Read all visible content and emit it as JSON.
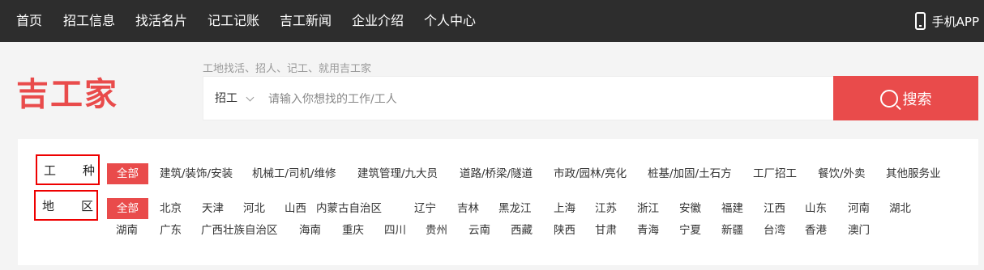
{
  "nav": {
    "items": [
      "首页",
      "招工信息",
      "找活名片",
      "记工记账",
      "吉工新闻",
      "企业介绍",
      "个人中心"
    ],
    "app_label": "手机APP"
  },
  "header": {
    "logo": "吉工家",
    "slogan": "工地找活、招人、记工、就用吉工家"
  },
  "search": {
    "type": "招工",
    "placeholder": "请输入你想找的工作/工人",
    "button_label": "搜索"
  },
  "filters": {
    "trade": {
      "label_a": "工",
      "label_b": "种",
      "options": [
        "全部",
        "建筑/装饰/安装",
        "机械工/司机/维修",
        "建筑管理/九大员",
        "道路/桥梁/隧道",
        "市政/园林/亮化",
        "桩基/加固/土石方",
        "工厂招工",
        "餐饮/外卖",
        "其他服务业"
      ]
    },
    "region": {
      "label_a": "地",
      "label_b": "区",
      "options": [
        "全部",
        "北京",
        "天津",
        "河北",
        "山西",
        "内蒙古自治区",
        "辽宁",
        "吉林",
        "黑龙江",
        "上海",
        "江苏",
        "浙江",
        "安徽",
        "福建",
        "江西",
        "山东",
        "河南",
        "湖北",
        "湖南",
        "广东",
        "广西壮族自治区",
        "海南",
        "重庆",
        "四川",
        "贵州",
        "云南",
        "西藏",
        "陕西",
        "甘肃",
        "青海",
        "宁夏",
        "新疆",
        "台湾",
        "香港",
        "澳门"
      ]
    }
  },
  "colors": {
    "accent": "#e94b4b",
    "nav_bg": "#2d2d2d"
  }
}
